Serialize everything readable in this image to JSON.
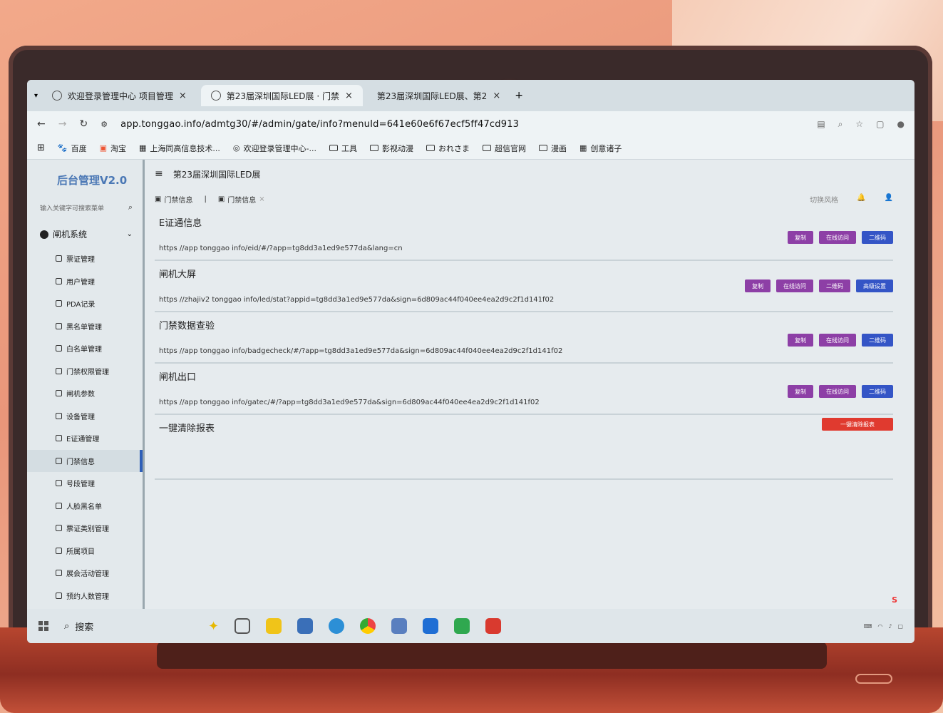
{
  "browser": {
    "tabs": [
      {
        "label": "欢迎登录管理中心   项目管理",
        "close": "×"
      },
      {
        "label": "第23届深圳国际LED展 · 门禁",
        "close": "×"
      },
      {
        "label": "第23届深圳国际LED展、第2",
        "close": "×"
      }
    ],
    "new_tab": "+",
    "url": "app.tonggao.info/admtg30/#/admin/gate/info?menuId=641e60e6f67ecf5ff47cd913",
    "bookmarks": [
      "百度",
      "淘宝",
      "上海同高信息技术...",
      "欢迎登录管理中心-...",
      "工具",
      "影视动漫",
      "おれさま",
      "超信官网",
      "漫画",
      "创意诸子"
    ]
  },
  "app": {
    "brand": "后台管理V2.0",
    "search_placeholder": "输入关键字可搜索菜单",
    "system": "闸机系统",
    "menu": [
      "票证管理",
      "用户管理",
      "PDA记录",
      "黑名单管理",
      "白名单管理",
      "门禁权限管理",
      "闸机参数",
      "设备管理",
      "E证通管理",
      "门禁信息",
      "号段管理",
      "人脸黑名单",
      "票证类别管理",
      "所属项目",
      "展会活动管理",
      "预约人数管理"
    ],
    "active_menu_index": 9,
    "page_title": "第23届深圳国际LED展",
    "tags": [
      "门禁信息",
      "门禁信息"
    ],
    "tag_close": "×",
    "right_tool": "切换风格"
  },
  "sections": [
    {
      "title": "E证通信息",
      "link": "https //app tonggao info/eid/#/?app=tg8dd3a1ed9e577da&lang=cn",
      "buttons": [
        "复制",
        "在线访问",
        "二维码"
      ]
    },
    {
      "title": "闸机大屏",
      "link": "https //zhajiv2 tonggao info/led/stat?appid=tg8dd3a1ed9e577da&sign=6d809ac44f040ee4ea2d9c2f1d141f02",
      "buttons": [
        "复制",
        "在线访问",
        "二维码",
        "高级设置"
      ]
    },
    {
      "title": "门禁数据查验",
      "link": "https //app tonggao info/badgecheck/#/?app=tg8dd3a1ed9e577da&sign=6d809ac44f040ee4ea2d9c2f1d141f02",
      "buttons": [
        "复制",
        "在线访问",
        "二维码"
      ]
    },
    {
      "title": "闸机出口",
      "link": "https //app tonggao info/gatec/#/?app=tg8dd3a1ed9e577da&sign=6d809ac44f040ee4ea2d9c2f1d141f02",
      "buttons": [
        "复制",
        "在线访问",
        "二维码"
      ]
    },
    {
      "title": "一键清除报表",
      "link": "",
      "buttons": [
        "一键清除报表"
      ]
    }
  ],
  "taskbar": {
    "search_label": "搜索",
    "ime_label": "S"
  },
  "colors": {
    "purple": "#8d3fa6",
    "blue": "#3455c6",
    "red": "#e03a2f",
    "brand": "#4b78b5"
  }
}
